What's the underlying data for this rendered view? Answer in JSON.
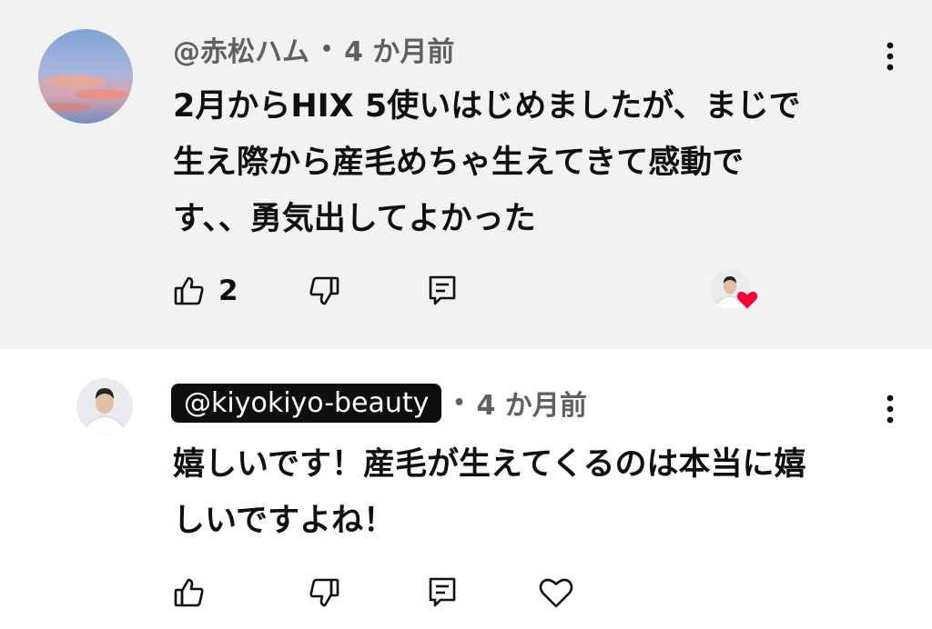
{
  "comments": [
    {
      "author": "@赤松ハム",
      "time": "4 か月前",
      "text_lines": [
        "2月からHIX 5使いはじめましたが、まじで",
        "生え際から産毛めちゃ生えてきて感動で",
        "す、、勇気出してよかった"
      ],
      "like_count": "2",
      "creator_heart": true
    },
    {
      "author": "@kiyokiyo-beauty",
      "time": "4 か月前",
      "text_lines": [
        "嬉しいです！産毛が生えてくるのは本当に嬉",
        "しいですよね！"
      ]
    }
  ],
  "meta_separator": "•",
  "colors": {
    "highlight_bg": "#f2f2f2",
    "heart": "#ff0033",
    "text": "#0f0f0f",
    "secondary": "#606060"
  }
}
